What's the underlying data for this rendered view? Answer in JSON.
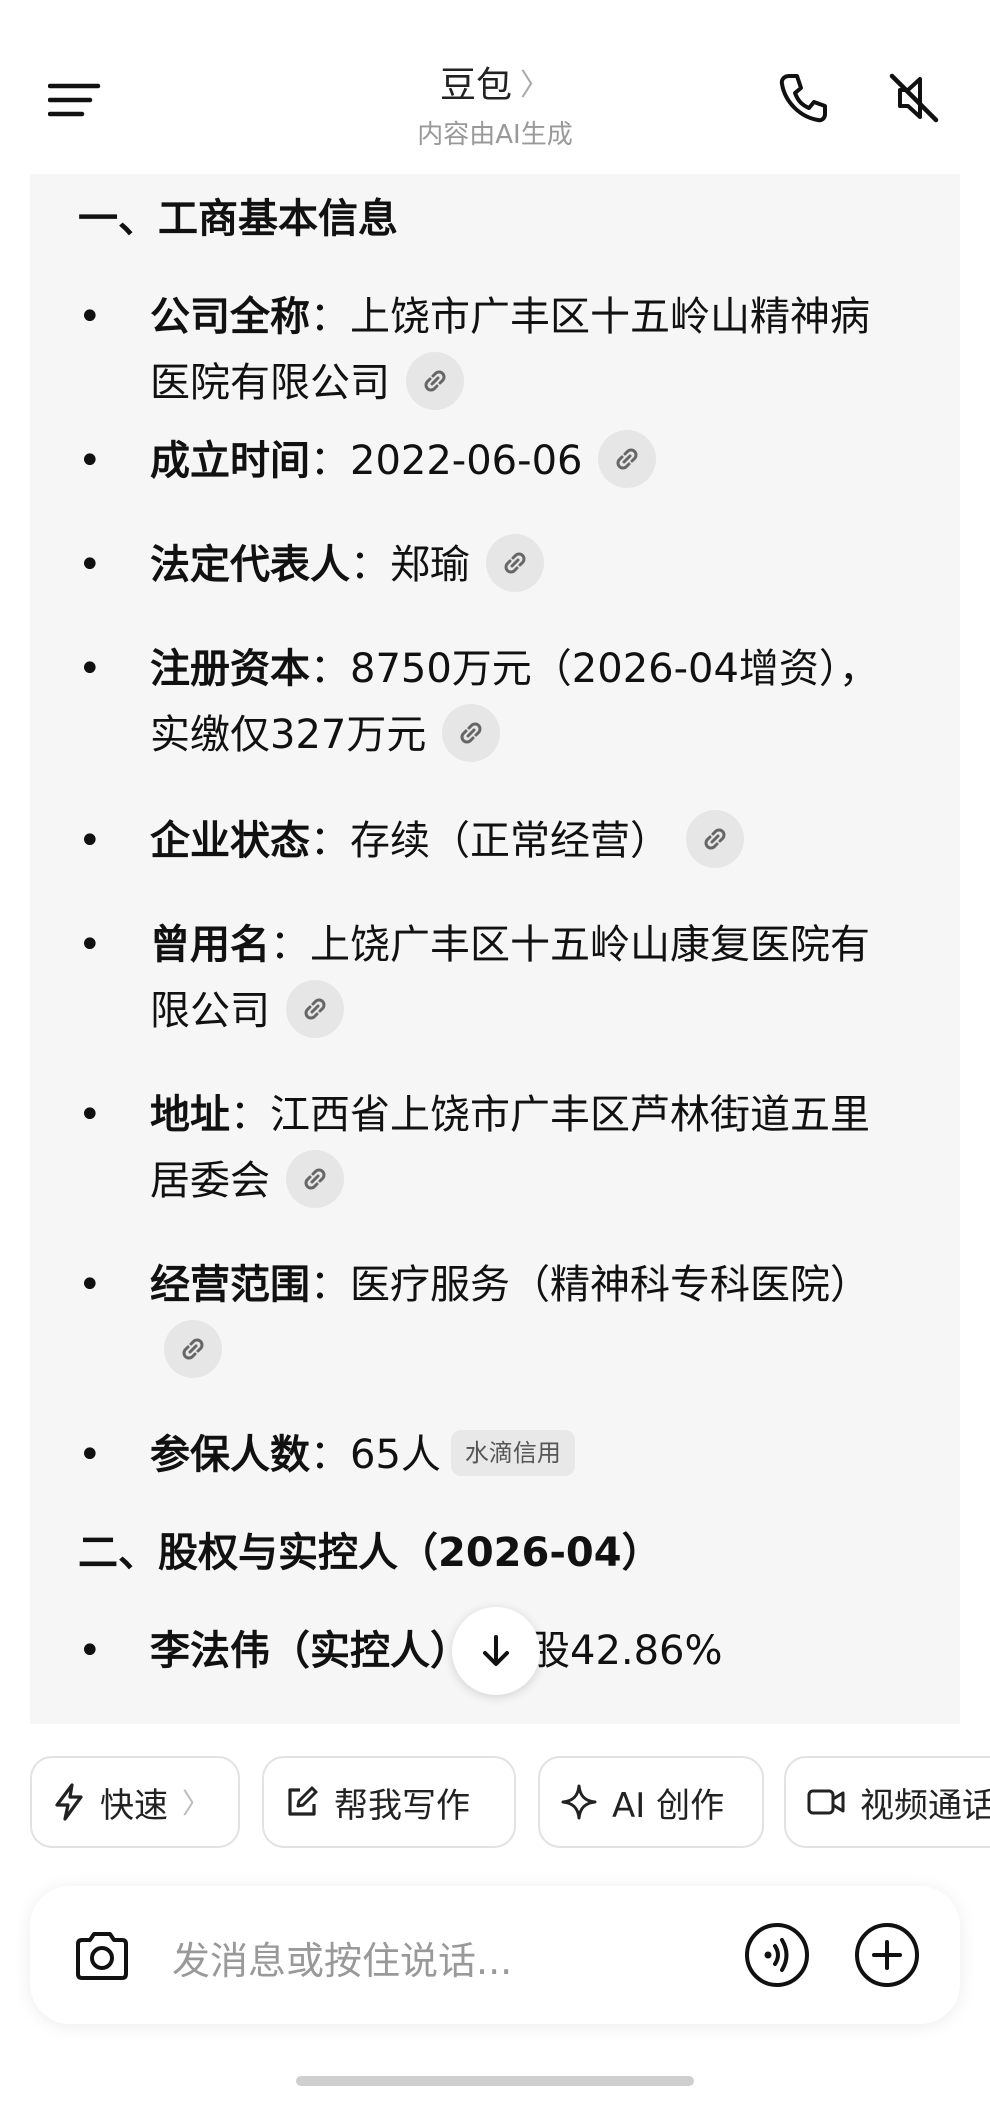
{
  "header": {
    "title": "豆包",
    "title_chevron": "〉",
    "subtitle": "内容由AI生成"
  },
  "content": {
    "section1_title": "一、工商基本信息",
    "items": [
      {
        "label": "公司全称",
        "sep": "：",
        "value_line1": "上饶市广丰区十五岭山精神病",
        "value_line2": "医院有限公司"
      },
      {
        "label": "成立时间",
        "sep": "：",
        "value_line1": "2022-06-06"
      },
      {
        "label": "法定代表人",
        "sep": "：",
        "value_line1": "郑瑜"
      },
      {
        "label": "注册资本",
        "sep": "：",
        "value_line1": "8750万元（2026-04增资），",
        "value_line2": "实缴仅327万元"
      },
      {
        "label": "企业状态",
        "sep": "：",
        "value_line1": "存续（正常经营）"
      },
      {
        "label": "曾用名",
        "sep": "：",
        "value_line1": "上饶广丰区十五岭山康复医院有",
        "value_line2": "限公司"
      },
      {
        "label": "地址",
        "sep": "：",
        "value_line1": "江西省上饶市广丰区芦林街道五里",
        "value_line2": "居委会"
      },
      {
        "label": "经营范围",
        "sep": "：",
        "value_line1": "医疗服务（精神科专科医院）"
      },
      {
        "label": "参保人数",
        "sep": "：",
        "value_line1": "65人",
        "badge": "水滴信用"
      }
    ],
    "section2_title": "二、股权与实控人（2026-04）",
    "partial_item": {
      "label": "李法伟（实控人）",
      "sep": "：",
      "value": "持股42.86%"
    },
    "bullet": "•"
  },
  "chips": [
    {
      "icon": "lightning-icon",
      "label": "快速",
      "chevron": "〉"
    },
    {
      "icon": "edit-icon",
      "label": "帮我写作"
    },
    {
      "icon": "sparkle-icon",
      "label": "AI 创作"
    },
    {
      "icon": "video-icon",
      "label": "视频通话"
    }
  ],
  "input": {
    "placeholder": "发消息或按住说话..."
  },
  "icons": {
    "menu": "menu-icon",
    "phone": "phone-icon",
    "mute": "mute-icon",
    "link": "link-icon",
    "scroll": "arrow-down-icon",
    "camera": "camera-icon",
    "voice": "voice-icon",
    "plus": "plus-icon"
  }
}
